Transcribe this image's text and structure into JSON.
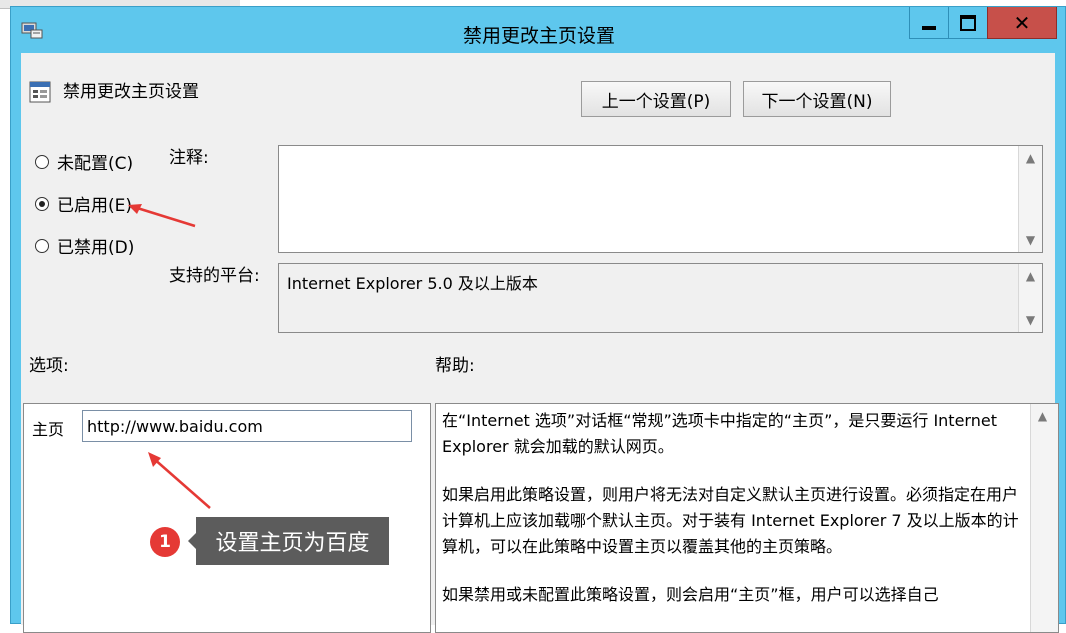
{
  "window": {
    "title": "禁用更改主页设置",
    "controls": {
      "minimize": "minimize",
      "maximize": "maximize",
      "close": "close"
    }
  },
  "policy": {
    "name": "禁用更改主页设置",
    "prev_button": "上一个设置(P)",
    "next_button": "下一个设置(N)"
  },
  "state_options": [
    {
      "label": "未配置(C)",
      "checked": false
    },
    {
      "label": "已启用(E)",
      "checked": true
    },
    {
      "label": "已禁用(D)",
      "checked": false
    }
  ],
  "labels": {
    "note": "注释:",
    "platform": "支持的平台:",
    "options": "选项:",
    "help": "帮助:"
  },
  "note": {
    "value": ""
  },
  "platform": {
    "value": "Internet Explorer 5.0 及以上版本"
  },
  "options": {
    "home_label": "主页",
    "home_value": "http://www.baidu.com"
  },
  "help": {
    "paragraphs": [
      "在“Internet 选项”对话框“常规”选项卡中指定的“主页”，是只要运行 Internet Explorer 就会加载的默认网页。",
      "如果启用此策略设置，则用户将无法对自定义默认主页进行设置。必须指定在用户计算机上应该加载哪个默认主页。对于装有 Internet Explorer 7 及以上版本的计算机，可以在此策略中设置主页以覆盖其他的主页策略。",
      "如果禁用或未配置此策略设置，则会启用“主页”框，用户可以选择自己"
    ]
  },
  "annotation": {
    "step": "1",
    "text": "设置主页为百度",
    "arrow_color": "#e53935"
  },
  "icons": {
    "app": "group-policy-icon",
    "policy": "policy-setting-icon"
  }
}
